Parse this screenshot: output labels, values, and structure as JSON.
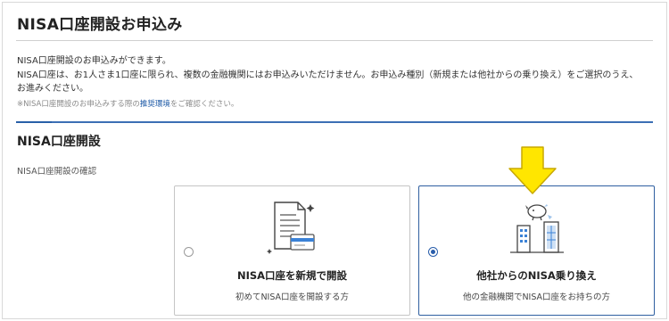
{
  "header": {
    "title": "NISA口座開設お申込み"
  },
  "intro": {
    "line1": "NISA口座開設のお申込みができます。",
    "line2": "NISA口座は、お1人さま1口座に限られ、複数の金融機関にはお申込みいただけません。お申込み種別（新規または他社からの乗り換え）をご選択のうえ、",
    "line3": "お進みください。"
  },
  "note": {
    "prefix": "※NISA口座開設のお申込みする際の",
    "link": "推奨環境",
    "suffix": "をご確認ください。"
  },
  "section": {
    "title": "NISA口座開設",
    "label": "NISA口座開設の確認"
  },
  "options": [
    {
      "title": "NISA口座を新規で開設",
      "subtitle": "初めてNISA口座を開設する方",
      "selected": false,
      "icon": "document-card-icon"
    },
    {
      "title": "他社からのNISA乗り換え",
      "subtitle": "他の金融機関でNISA口座をお持ちの方",
      "selected": true,
      "icon": "buildings-piggybank-icon"
    }
  ],
  "colors": {
    "accent": "#2a5eab",
    "arrow": "#ffe600",
    "arrow_stroke": "#c8a800"
  }
}
